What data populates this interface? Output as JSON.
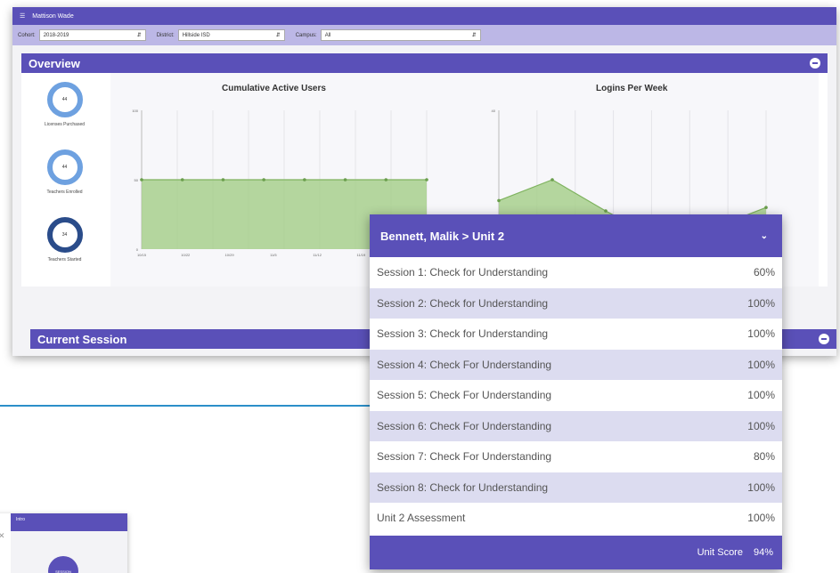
{
  "topbar": {
    "title": "Mattison Wade"
  },
  "filters": [
    {
      "label": "Cohort:",
      "value": "2018-2019"
    },
    {
      "label": "District:",
      "value": "Hillside ISD"
    },
    {
      "label": "Campus:",
      "value": "All"
    }
  ],
  "overview": {
    "title": "Overview",
    "rings": [
      {
        "value": "44",
        "label": "Licenses Purchased"
      },
      {
        "value": "44",
        "label": "Teachers Enrolled"
      },
      {
        "value": "34",
        "label": "Teachers Started"
      }
    ]
  },
  "chart_data": [
    {
      "type": "area",
      "title": "Cumulative Active Users",
      "y_ticks": [
        "100",
        "50",
        "0"
      ],
      "x_ticks": [
        "10/15",
        "10/22",
        "10/29",
        "11/5",
        "11/12",
        "11/19"
      ],
      "values": [
        50,
        50,
        50,
        50,
        50,
        50,
        50,
        50
      ],
      "ylim": [
        0,
        100
      ],
      "color": "#a8d08d"
    },
    {
      "type": "area",
      "title": "Logins Per Week",
      "y_ticks": [
        "40"
      ],
      "values": [
        14,
        20,
        11,
        3,
        6,
        12
      ],
      "ylim": [
        0,
        40
      ],
      "color": "#a8d08d"
    }
  ],
  "current_session": {
    "title": "Current Session"
  },
  "popup": {
    "title": "Bennett, Malik > Unit 2",
    "rows": [
      {
        "label": "Session 1: Check for Understanding",
        "score": "60%"
      },
      {
        "label": "Session 2: Check for Understanding",
        "score": "100%"
      },
      {
        "label": "Session 3: Check for Understanding",
        "score": "100%"
      },
      {
        "label": "Session 4: Check For Understanding",
        "score": "100%"
      },
      {
        "label": "Session 5: Check For Understanding",
        "score": "100%"
      },
      {
        "label": "Session 6: Check For Understanding",
        "score": "100%"
      },
      {
        "label": "Session 7: Check For Understanding",
        "score": "80%"
      },
      {
        "label": "Session 8: Check for Understanding",
        "score": "100%"
      },
      {
        "label": "Unit 2 Assessment",
        "score": "100%"
      }
    ],
    "footer_label": "Unit Score",
    "footer_value": "94%"
  },
  "thumbnail": {
    "top_text": "Intro",
    "circle_text": "SESSION"
  },
  "colors": {
    "primary": "#5a50b8",
    "filter_bar": "#bcb7e6",
    "row_alt": "#dcdcf0",
    "ring": "#6ea1e0",
    "ring_dark": "#2a4c8a",
    "area_fill": "#a8d08d",
    "divider": "#2b8fc9"
  }
}
